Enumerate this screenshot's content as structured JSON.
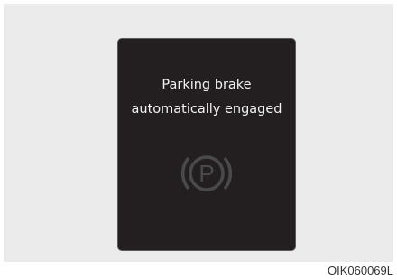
{
  "display": {
    "message_line1": "Parking brake",
    "message_line2": "automatically engaged",
    "icon": "parking-brake-icon",
    "icon_letter": "P",
    "icon_color": "#4a4a4a",
    "background_color": "#231f20"
  },
  "caption": "OIK060069L"
}
